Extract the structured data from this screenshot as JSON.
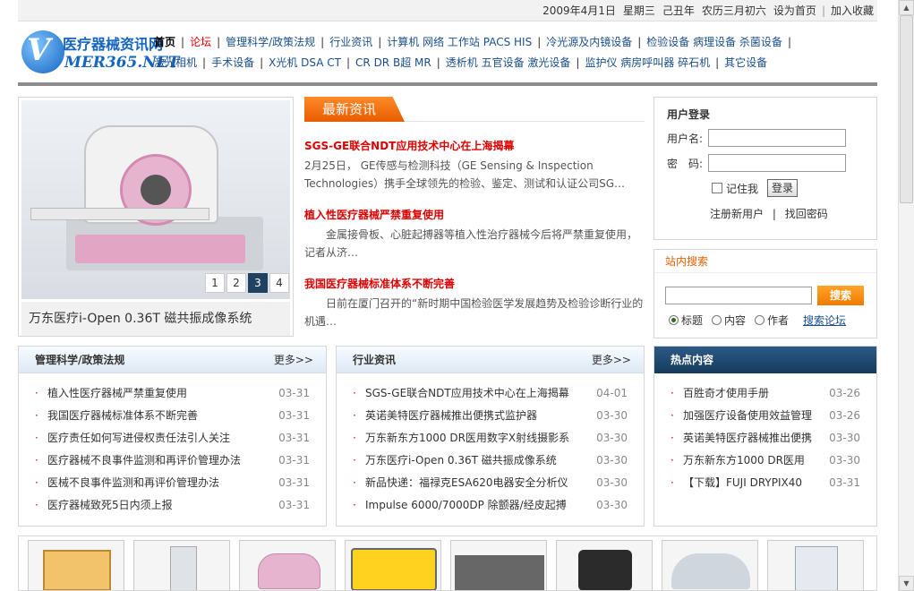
{
  "topbar": {
    "date": "2009年4月1日",
    "weekday": "星期三",
    "year": "己丑年",
    "lunar": "农历三月初六",
    "set_home": "设为首页",
    "favorite": "加入收藏"
  },
  "logo": {
    "cn": "医疗器械资讯网",
    "en": "MER365.NET",
    "v": "V"
  },
  "nav": [
    "首页",
    "论坛",
    "管理科学/政策法规",
    "行业资讯",
    "计算机 网络 工作站 PACS HIS",
    "冷光源及内镜设备",
    "检验设备 病理设备 杀菌设备",
    "激光相机",
    "手术设备",
    "X光机 DSA CT",
    "CR DR B超 MR",
    "透析机 五官设备 激光设备",
    "监护仪 病房呼叫器 碎石机",
    "其它设备"
  ],
  "feature": {
    "pager": [
      "1",
      "2",
      "3",
      "4"
    ],
    "active": "3",
    "caption": "万东医疗i-Open 0.36T 磁共振成像系统"
  },
  "news": {
    "tab": "最新资讯",
    "items": [
      {
        "title": "SGS-GE联合NDT应用技术中心在上海揭幕",
        "desc": "2月25日， GE传感与检测科技（GE Sensing & Inspection Technologies）携手全球领先的检验、鉴定、测试和认证公司SG…"
      },
      {
        "title": "植入性医疗器械严禁重复使用",
        "desc": "金属接骨板、心脏起搏器等植入性治疗器械今后将严禁重复使用，记者从济…"
      },
      {
        "title": "我国医疗器械标准体系不断完善",
        "desc": "日前在厦门召开的“新时期中国检验医学发展趋势及检验诊断行业的机遇…"
      }
    ]
  },
  "login": {
    "title": "用户登录",
    "username_label": "用户名:",
    "password_label": "密　码:",
    "remember": "记住我",
    "submit": "登录",
    "register": "注册新用户",
    "find_password": "找回密码"
  },
  "search": {
    "title": "站内搜索",
    "button": "搜索",
    "options": [
      "标题",
      "内容",
      "作者"
    ],
    "selected": "标题",
    "forum_link": "搜索论坛"
  },
  "panels": {
    "management": {
      "title": "管理科学/政策法规",
      "more": "更多>>",
      "items": [
        {
          "t": "植入性医疗器械严禁重复使用",
          "d": "03-31"
        },
        {
          "t": "我国医疗器械标准体系不断完善",
          "d": "03-31"
        },
        {
          "t": "医疗责任如何写进侵权责任法引人关注",
          "d": "03-31"
        },
        {
          "t": "医疗器械不良事件监测和再评价管理办法",
          "d": "03-31"
        },
        {
          "t": "医械不良事件监测和再评价管理办法",
          "d": "03-31"
        },
        {
          "t": "医疗器械致死5日内须上报",
          "d": "03-31"
        }
      ]
    },
    "industry": {
      "title": "行业资讯",
      "more": "更多>>",
      "items": [
        {
          "t": "SGS-GE联合NDT应用技术中心在上海揭幕",
          "d": "04-01"
        },
        {
          "t": "英诺美特医疗器械推出便携式监护器",
          "d": "03-30"
        },
        {
          "t": "万东新东方1000 DR医用数字X射线摄影系",
          "d": "03-30"
        },
        {
          "t": "万东医疗i-Open 0.36T 磁共振成像系统",
          "d": "03-30"
        },
        {
          "t": "新品快递：福禄克ESA620电器安全分析仪",
          "d": "03-30"
        },
        {
          "t": "Impulse 6000/7000DP 除颤器/经皮起搏",
          "d": "03-30"
        }
      ]
    },
    "hot": {
      "title": "热点内容",
      "items": [
        {
          "t": "百胜奇才使用手册",
          "d": "03-26"
        },
        {
          "t": "加强医疗设备使用效益管理",
          "d": "03-26"
        },
        {
          "t": "英诺美特医疗器械推出便携",
          "d": "03-30"
        },
        {
          "t": "万东新东方1000 DR医用",
          "d": "03-30"
        },
        {
          "t": "【下载】FUJI DRYPIX40",
          "d": "03-31"
        }
      ]
    }
  }
}
